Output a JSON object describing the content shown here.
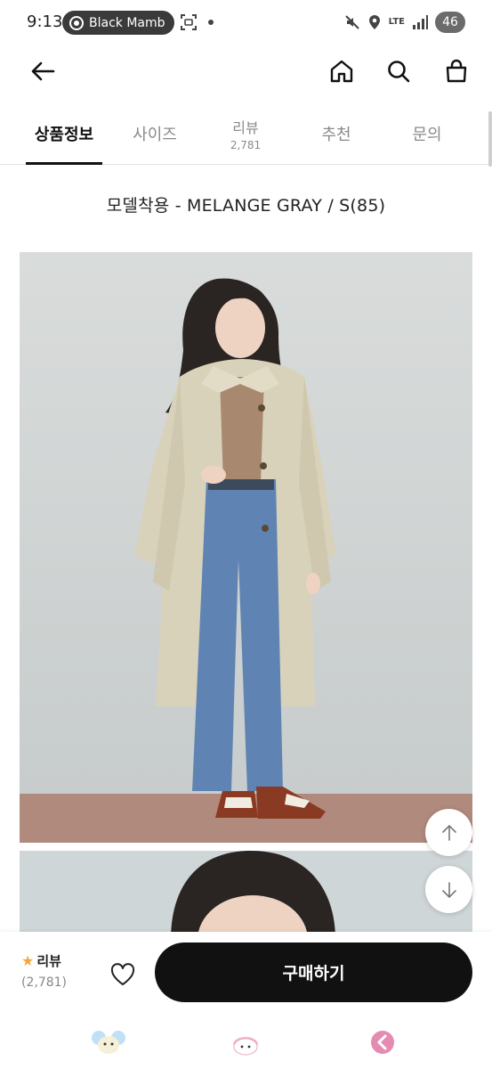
{
  "status_bar": {
    "time": "9:13",
    "pill_label": "Black Mamb",
    "network": "LTE",
    "battery": "46"
  },
  "header": {
    "icons": [
      "back-arrow-icon",
      "home-icon",
      "search-icon",
      "shopping-bag-icon"
    ]
  },
  "tabs": [
    {
      "label": "상품정보",
      "active": true
    },
    {
      "label": "사이즈"
    },
    {
      "label": "리뷰",
      "count": "2,781"
    },
    {
      "label": "추천"
    },
    {
      "label": "문의"
    }
  ],
  "product": {
    "model_caption": "모델착용 -  MELANGE GRAY / S(85)"
  },
  "buy_bar": {
    "review_label": "리뷰",
    "review_count": "(2,781)",
    "buy_label": "구매하기"
  },
  "colors": {
    "accent": "#111111",
    "star": "#f3a63b",
    "muted": "#8a8a8a"
  }
}
